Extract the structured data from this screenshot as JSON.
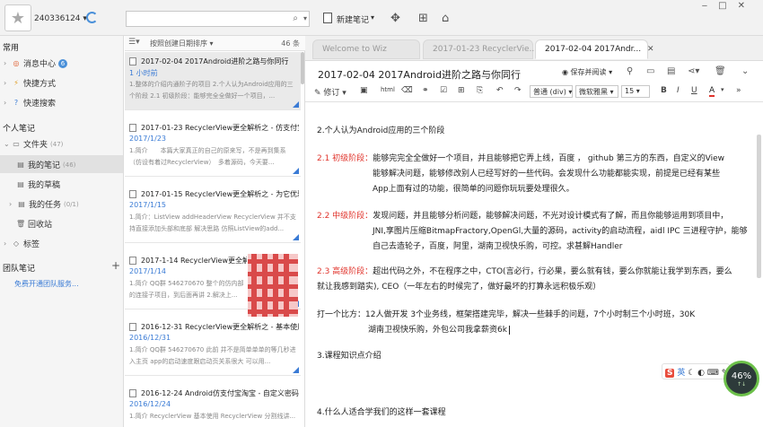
{
  "topbar": {
    "user_id": "240336124",
    "search_placeholder": "",
    "new_note_label": "新建笔记",
    "window_controls": [
      "‒",
      "□",
      "✕"
    ],
    "window_extra": "⌂"
  },
  "sidebar": {
    "section_common": "常用",
    "items_common": [
      {
        "label": "消息中心",
        "icon": "message-icon",
        "badge": "6"
      },
      {
        "label": "快捷方式",
        "icon": "shortcut-icon"
      },
      {
        "label": "快速搜索",
        "icon": "quick-search-icon"
      }
    ],
    "section_personal": "个人笔记",
    "folder": {
      "label": "文件夹",
      "count": "(47)"
    },
    "sub_items": [
      {
        "label": "我的笔记",
        "count": "(46)",
        "icon": "note-folder-icon"
      },
      {
        "label": "我的草稿",
        "count": "",
        "icon": "draft-icon"
      },
      {
        "label": "我的任务",
        "count": "(0/1)",
        "icon": "task-icon"
      },
      {
        "label": "回收站",
        "count": "",
        "icon": "trash-icon"
      }
    ],
    "tags": "标签",
    "section_team": "团队笔记",
    "team_link": "免费开通团队服务..."
  },
  "list": {
    "sort_label": "按照创建日期排序",
    "count": "46 条",
    "notes": [
      {
        "title": "2017-02-04 2017Android进阶之路与你同行",
        "date": "1 小时前",
        "snippet": "1.整体的介绍内通阶子的项目 2.个人认为Android应用的三个阶段 2.1 初级阶段：能够完全全做好一个项目，..."
      },
      {
        "title": "2017-01-23 RecyclerView更全解析之 - 仿支付宝...",
        "date": "2017/1/23",
        "snippet": "1.简介　　本篇大家真正的自己的原来写，不是再到集系（仿设有着过RecyclerView）　多着源码，今天要..."
      },
      {
        "title": "2017-01-15 RecyclerView更全解析之 - 为它优雅...",
        "date": "2017/1/15",
        "snippet": "1.简介：ListView addHeaderView RecyclerView 并不支持直接添加头部和底部 解决思路 仿照ListView的add..."
      },
      {
        "title": "2017-1-14 RecyclerView更全解...",
        "date": "2017/1/14",
        "snippet": "1.简介 QQ群 546270670 整个的仿内部的连接子项目，到后面再讲 2.解决上..."
      },
      {
        "title": "2016-12-31 RecyclerView更全解析之 - 基本使用...",
        "date": "2016/12/31",
        "snippet": "1.简介 QQ群 546270670 此前 并不是简单单单的等几秒进入主页 app的启动速度跟启动页关系很大 可以用..."
      },
      {
        "title": "2016-12-24 Android仿支付宝淘宝 - 自定义密码...",
        "date": "2016/12/24",
        "snippet": "1.简介 RecyclerView 基本使用 RecyclerView 分割线讲..."
      }
    ]
  },
  "tabs": [
    {
      "label": "Welcome to Wiz"
    },
    {
      "label": "2017-01-23 RecyclerVie..."
    },
    {
      "label": "2017-02-04 2017Andr...",
      "close": "✕"
    }
  ],
  "doc": {
    "title": "2017-02-04 2017Android进阶之路与你同行",
    "read_mode": "保存并阅读",
    "edit": "修订",
    "style_select": "普通 (div)",
    "font_select": "微软雅黑",
    "size_select": "15",
    "lines": [
      {
        "text": "2.个人认为Android应用的三个阶段"
      },
      {
        "label": "2.1 初级阶段：",
        "text": "能够完完全全做好一个项目，并且能够把它弄上线，百度 ， github 第三方的东西，自定义的View"
      },
      {
        "text": "能够解决问题，能够修改别人已经写好的一些代码。会发现什么功能都能实现，前提是已经有某些"
      },
      {
        "text": "App上面有过的功能，很简单的问题你玩玩要处理很久。"
      },
      {
        "label": "2.2 中级阶段：",
        "text": "发现问题，并且能够分析问题，能够解决问题，不光对设计模式有了解，而且你能够运用到项目中，"
      },
      {
        "text": "JNI,享图片压缩BitmapFractory,OpenGl,大量的源码，activity的启动流程，aidl IPC 三进程守护，能够"
      },
      {
        "text": "自己去造轮子，百度，阿里，湖南卫视快乐购，可控。求甚解Handler"
      },
      {
        "label": "2.3 高级阶段：",
        "text": "超出代码之外，不在程序之中，CTO(言必行，行必果，要么就有钱，要么你就能让我学到东西，要么"
      },
      {
        "text": "就让我感到踏实), CEO（一年左右的时候完了，做好最坏的打算永远积极乐观）"
      },
      {
        "text": "打一个比方：12人做开发  3个业务线，框架搭建完毕，解决一些棘手的问题，7个小时制三个小时班，30K"
      },
      {
        "text": "湖南卫视快乐购，外包公司我拿薪资6k"
      },
      {
        "text": "3.课程知识点介绍"
      },
      {
        "text": "4.什么人适合学我们的这样一套课程"
      }
    ]
  },
  "ime": {
    "logo": "S",
    "lang": "英"
  },
  "gauge": {
    "percent": "46%"
  }
}
